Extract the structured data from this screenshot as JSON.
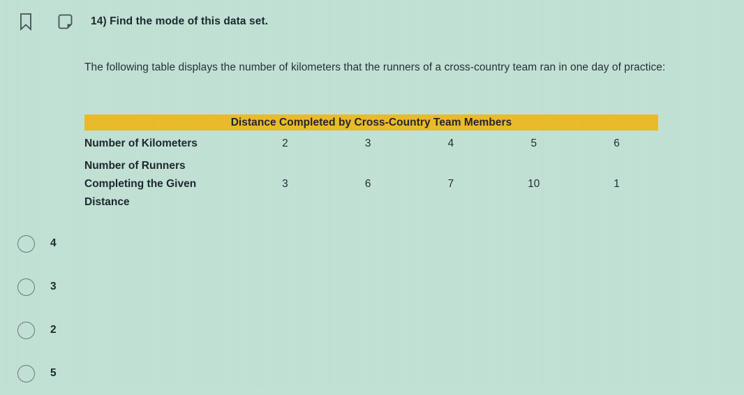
{
  "page": {
    "background_color": "#c0e1d3",
    "accent_color": "#eab925",
    "text_color": "#17202a"
  },
  "toolbar": {
    "bookmark_icon": "bookmark-icon",
    "note_icon": "note-icon"
  },
  "question": {
    "number_label": "14) Find the mode of this data set.",
    "prompt": "The following table displays the number of kilometers that the runners of a cross-country team ran in one day of practice:"
  },
  "table": {
    "caption": "Distance Completed by Cross-Country Team Members",
    "rows": [
      {
        "label": "Number of Kilometers",
        "values": [
          "2",
          "3",
          "4",
          "5",
          "6"
        ]
      },
      {
        "label": "Number of Runners\nCompleting the Given\nDistance",
        "values": [
          "3",
          "6",
          "7",
          "10",
          "1"
        ]
      }
    ]
  },
  "answers": {
    "options": [
      {
        "label": "4",
        "selected": false
      },
      {
        "label": "3",
        "selected": false
      },
      {
        "label": "2",
        "selected": false
      },
      {
        "label": "5",
        "selected": false
      }
    ]
  },
  "chart_data": {
    "type": "table",
    "title": "Distance Completed by Cross-Country Team Members",
    "categories": [
      "2",
      "3",
      "4",
      "5",
      "6"
    ],
    "xlabel": "Number of Kilometers",
    "ylabel": "Number of Runners Completing the Given Distance",
    "series": [
      {
        "name": "Number of Runners Completing the Given Distance",
        "values": [
          3,
          6,
          7,
          10,
          1
        ]
      }
    ]
  }
}
